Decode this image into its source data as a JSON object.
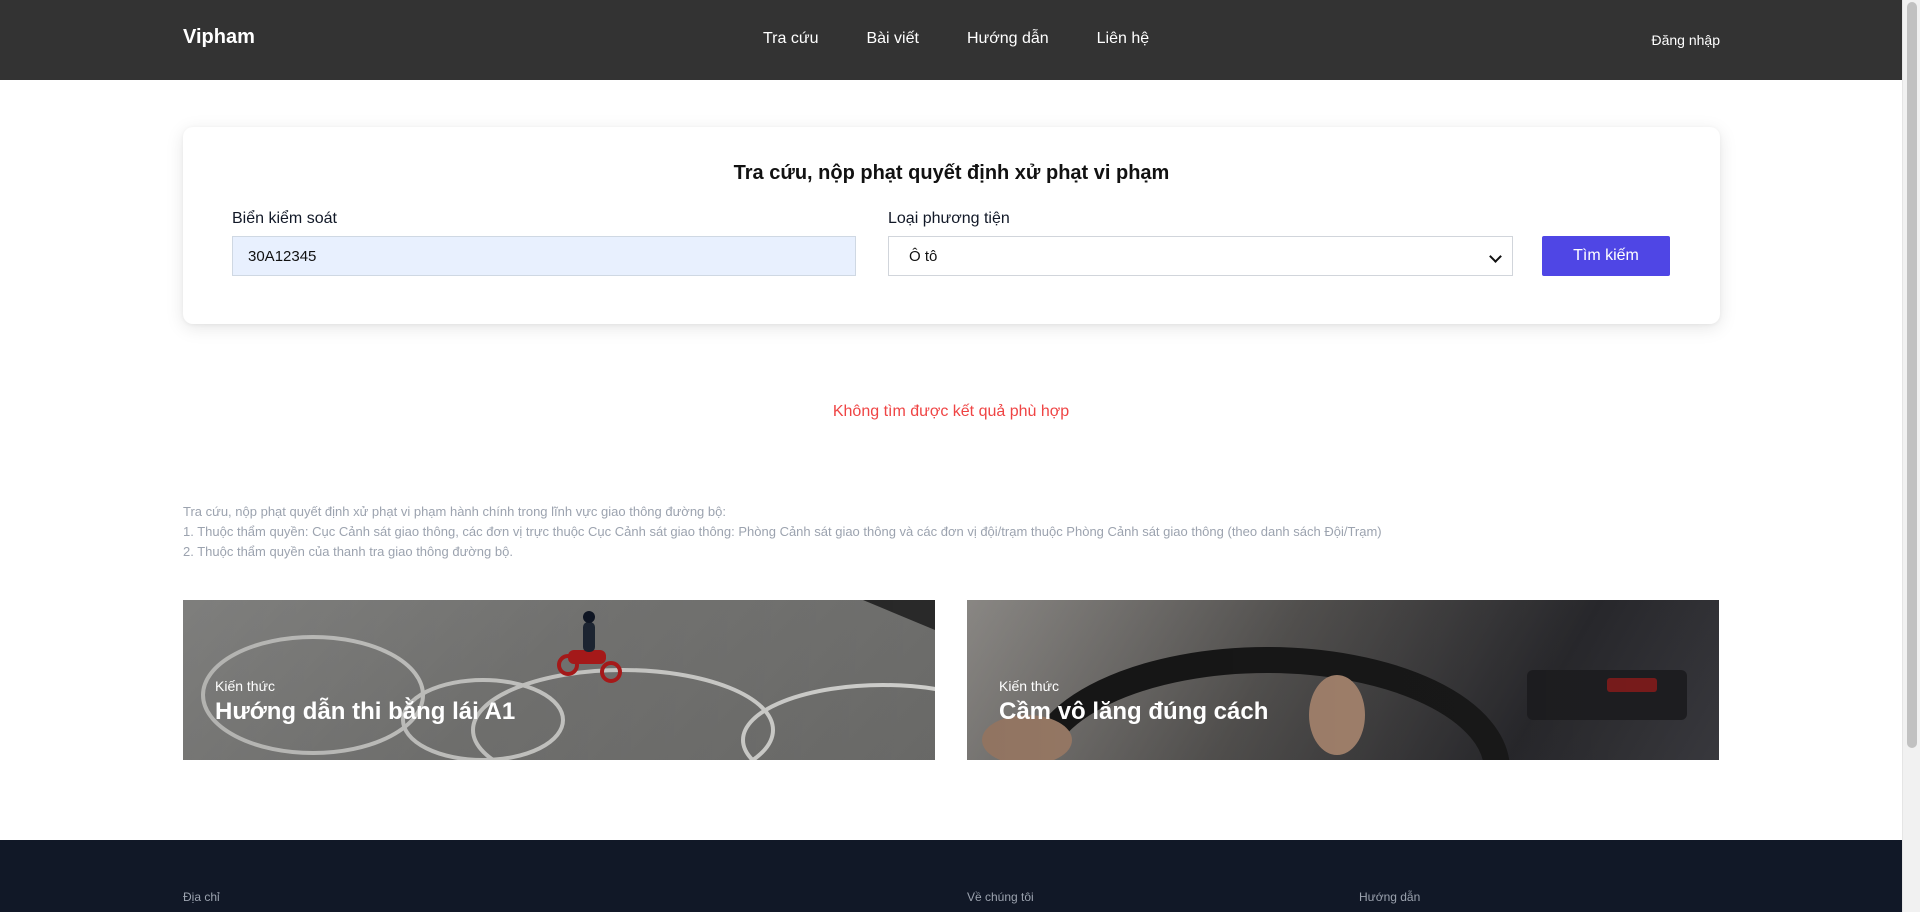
{
  "header": {
    "brand": "Vipham",
    "nav": [
      "Tra cứu",
      "Bài viết",
      "Hướng dẫn",
      "Liên hệ"
    ],
    "login": "Đăng nhập"
  },
  "search": {
    "title": "Tra cứu, nộp phạt quyết định xử phạt vi phạm",
    "plate_label": "Biển kiểm soát",
    "plate_value": "30A12345",
    "vehicle_label": "Loại phương tiện",
    "vehicle_value": "Ô tô",
    "button": "Tìm kiếm"
  },
  "result": {
    "message": "Không tìm được kết quả phù hợp"
  },
  "description": [
    "Tra cứu, nộp phạt quyết định xử phạt vi phạm hành chính trong lĩnh vực giao thông đường bộ:",
    "1. Thuộc thẩm quyền: Cục Cảnh sát giao thông, các đơn vị trực thuộc Cục Cảnh sát giao thông: Phòng Cảnh sát giao thông và các đơn vị đội/trạm thuộc Phòng Cảnh sát giao thông (theo danh sách Đội/Trạm)",
    "2. Thuộc thẩm quyền của thanh tra giao thông đường bộ."
  ],
  "articles": [
    {
      "category": "Kiến thức",
      "title": "Hướng dẫn thi bằng lái A1"
    },
    {
      "category": "Kiến thức",
      "title": "Cầm vô lăng đúng cách"
    }
  ],
  "footer": {
    "address": "Địa chỉ",
    "about": "Về chúng tôi",
    "guide": "Hướng dẫn"
  },
  "colors": {
    "header_bg": "#333333",
    "accent": "#4f46e5",
    "error": "#ef4444",
    "footer_bg": "#111827"
  }
}
